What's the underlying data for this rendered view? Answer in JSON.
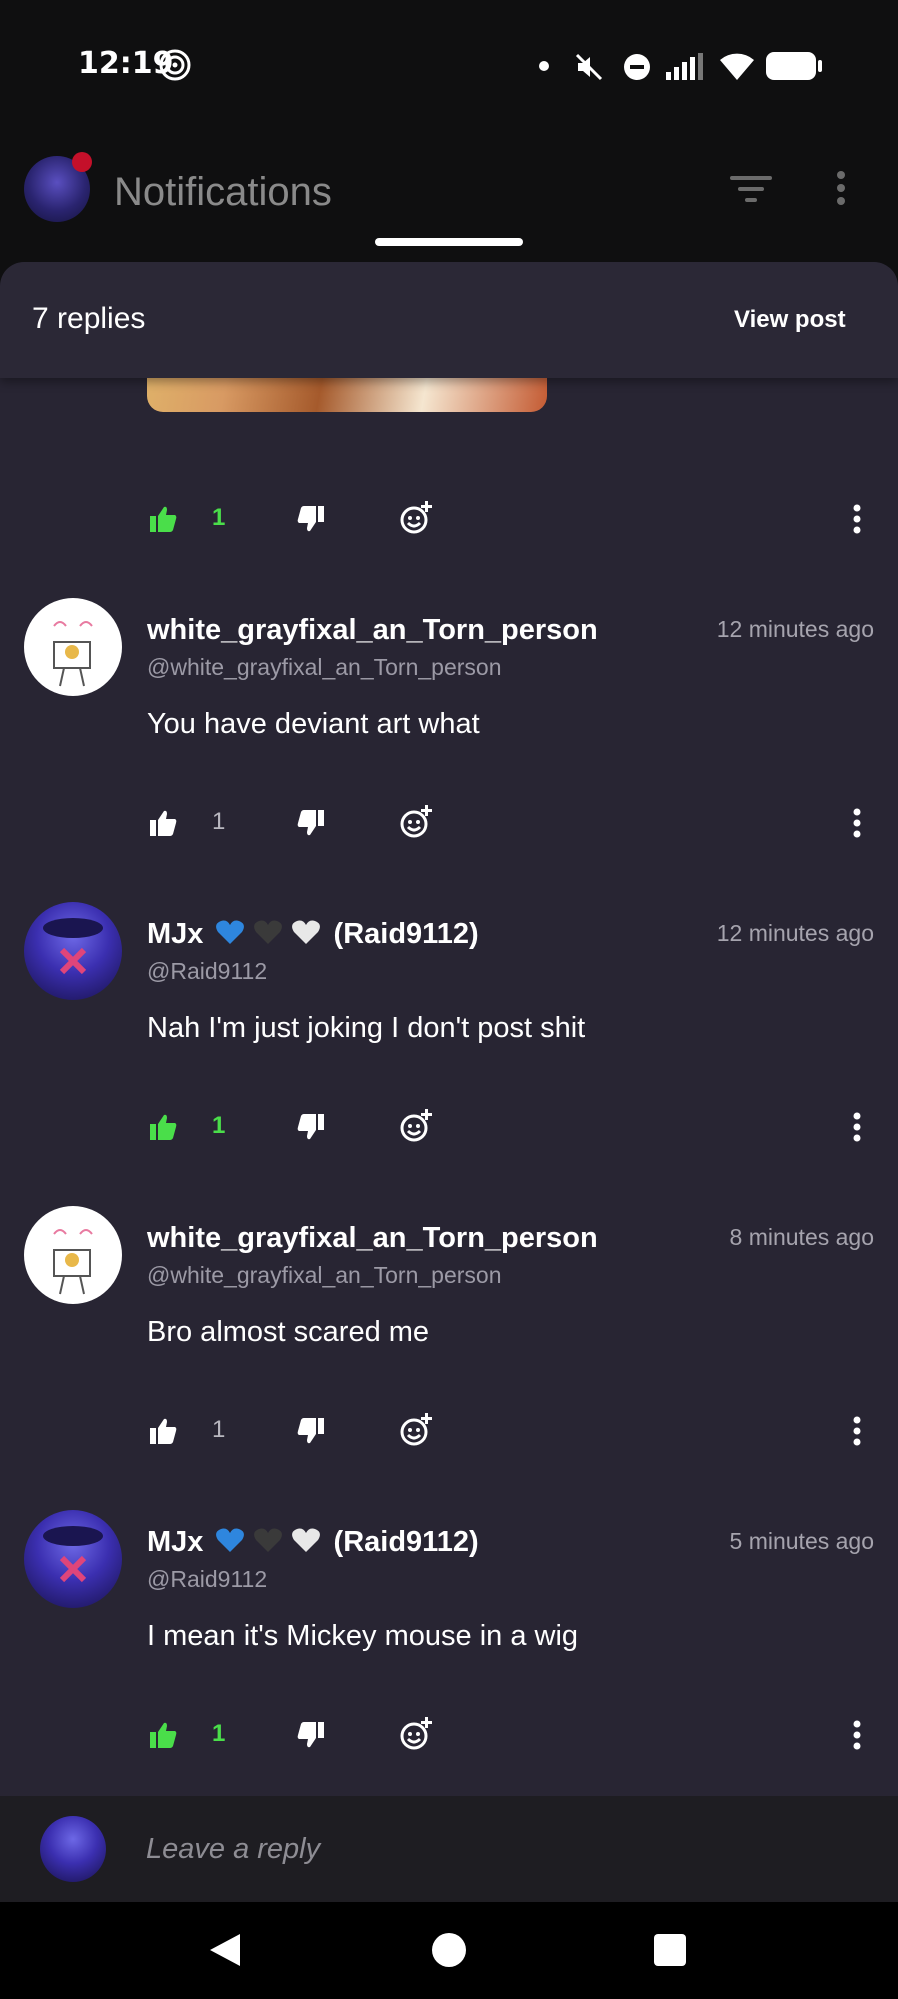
{
  "status_bar": {
    "time": "12:19"
  },
  "header": {
    "title": "Notifications"
  },
  "sheet": {
    "replies_count": "7 replies",
    "view_post_label": "View post"
  },
  "colors": {
    "like_active": "#4ade4a",
    "sheet_bg": "#282533",
    "accent_red": "#c4102a"
  },
  "top_post_actions": {
    "likes": "1",
    "liked": true
  },
  "comments": [
    {
      "username": "white_grayfixal_an_Torn_person",
      "handle": "@white_grayfixal_an_Torn_person",
      "time": "12 minutes ago",
      "text": "You have deviant art what",
      "likes": "1",
      "liked": false,
      "avatar": "white-character-avatar"
    },
    {
      "username_main": "MJx",
      "username_suffix": "(Raid9112)",
      "hearts": [
        "blue-heart",
        "black-heart",
        "white-heart"
      ],
      "handle": "@Raid9112",
      "time": "12 minutes ago",
      "text": "Nah I'm just joking I don't post shit",
      "likes": "1",
      "liked": true,
      "avatar": "blue-character-avatar"
    },
    {
      "username": "white_grayfixal_an_Torn_person",
      "handle": "@white_grayfixal_an_Torn_person",
      "time": "8 minutes ago",
      "text": "Bro almost scared me",
      "likes": "1",
      "liked": false,
      "avatar": "white-character-avatar"
    },
    {
      "username_main": "MJx",
      "username_suffix": "(Raid9112)",
      "hearts": [
        "blue-heart",
        "black-heart",
        "white-heart"
      ],
      "handle": "@Raid9112",
      "time": "5 minutes ago",
      "text": "I mean it's Mickey mouse in a wig",
      "likes": "1",
      "liked": true,
      "avatar": "blue-character-avatar"
    }
  ],
  "reply_bar": {
    "placeholder": "Leave a reply"
  }
}
